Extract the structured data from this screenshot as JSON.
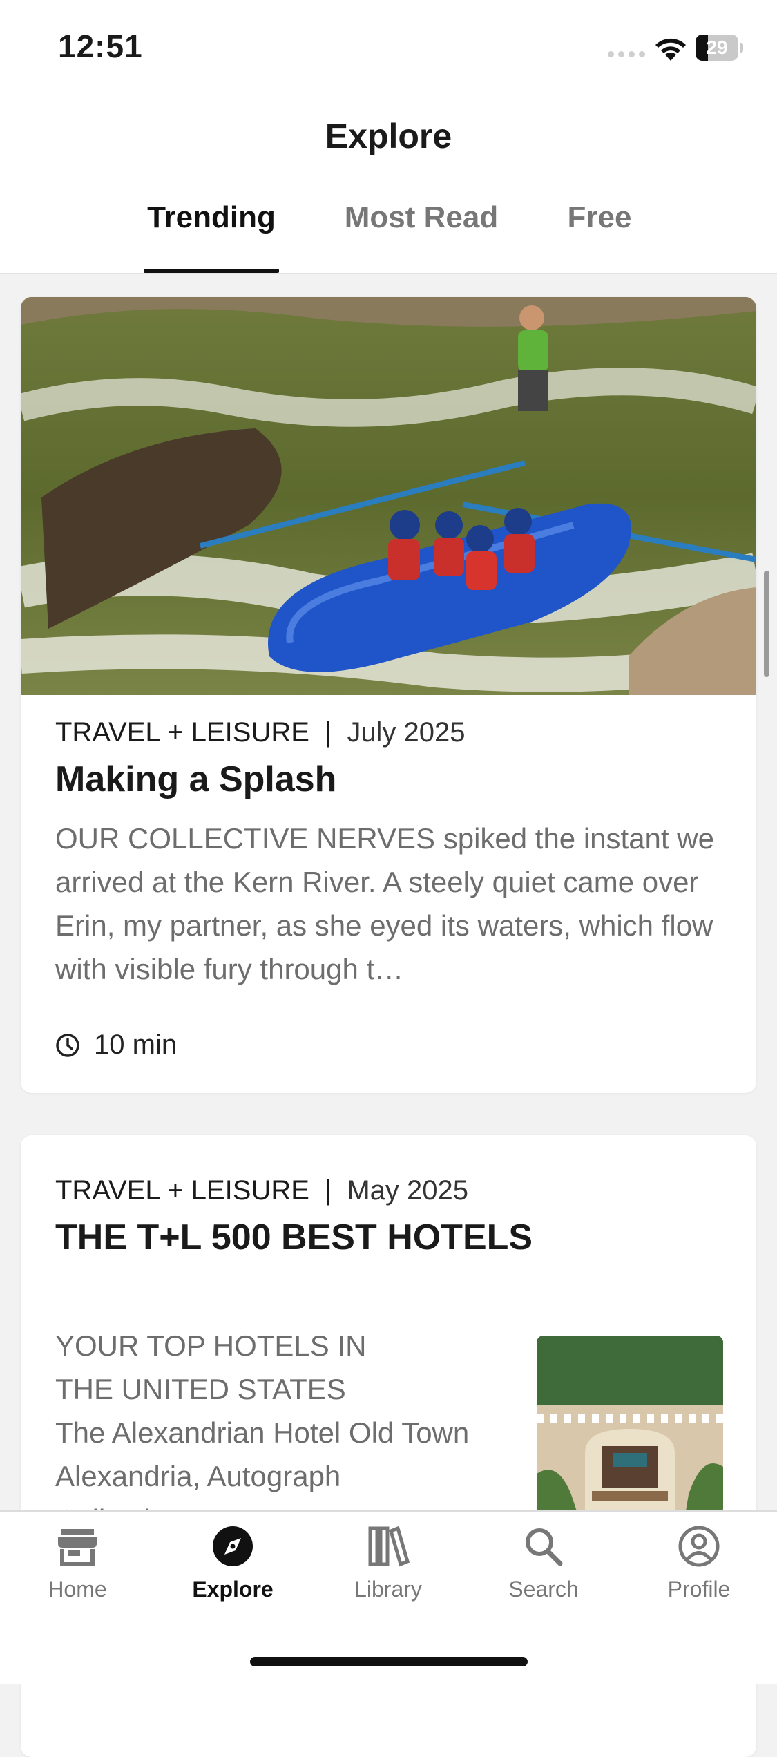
{
  "status": {
    "time": "12:51",
    "battery": "29",
    "battery_level": 0.29
  },
  "header": {
    "title": "Explore"
  },
  "tabs": [
    {
      "label": "Trending",
      "active": true
    },
    {
      "label": "Most Read",
      "active": false
    },
    {
      "label": "Free",
      "active": false
    }
  ],
  "articles": [
    {
      "publication": "TRAVEL + LEISURE",
      "separator": "|",
      "date": "July 2025",
      "title": "Making a Splash",
      "excerpt": "OUR COLLECTIVE NERVES spiked the instant we arrived at the Kern River. A steely quiet came over Erin, my partner, as she eyed its waters, which flow with visible fury through t…",
      "read_time": "10 min",
      "image": "whitewater-rafting-photo"
    },
    {
      "publication": "TRAVEL + LEISURE",
      "separator": "|",
      "date": "May 2025",
      "title": "THE T+L 500 BEST HOTELS",
      "excerpt_line1": "YOUR TOP HOTELS IN",
      "excerpt_line2": "THE UNITED STATES",
      "excerpt_line3": "The Alexandrian Hotel Old Town",
      "excerpt_line4": "Alexandria, Autograph",
      "excerpt_line5": "Collection",
      "image": "hotel-entrance-thumbnail"
    }
  ],
  "nav": [
    {
      "label": "Home",
      "icon": "storefront-icon"
    },
    {
      "label": "Explore",
      "icon": "compass-icon",
      "active": true
    },
    {
      "label": "Library",
      "icon": "library-books-icon"
    },
    {
      "label": "Search",
      "icon": "search-icon"
    },
    {
      "label": "Profile",
      "icon": "person-circle-icon"
    }
  ],
  "colors": {
    "accent": "#111111",
    "muted": "#777777",
    "background": "#f2f2f2"
  }
}
